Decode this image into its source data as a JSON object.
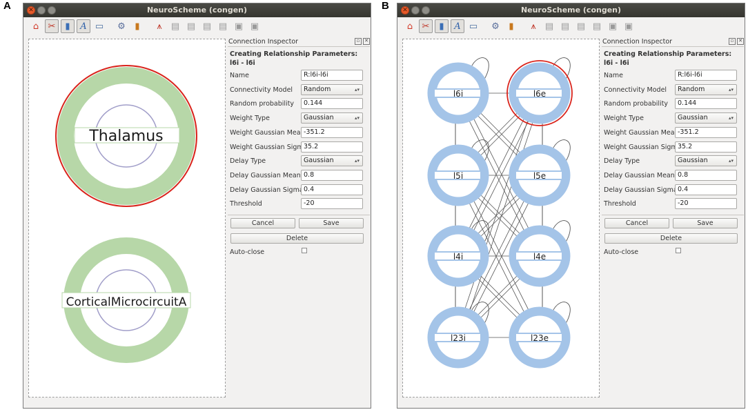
{
  "panels": [
    {
      "letter": "A",
      "window_title": "NeuroScheme (congen)",
      "toolbar_icons": [
        "home-icon",
        "scissors-icon",
        "battery-icon",
        "text-icon",
        "panel-icon",
        "separator",
        "gear-icon",
        "book-icon",
        "separator",
        "antenna-icon",
        "clipboard-icon",
        "clipboard-icon",
        "clipboard-icon",
        "clipboard-icon",
        "window-icon",
        "window-icon"
      ],
      "inspector": {
        "title": "Connection Inspector",
        "heading_line1": "Creating Relationship Parameters:",
        "heading_line2": "l6i - l6i",
        "fields": [
          {
            "label": "Name",
            "value": "R:l6i-l6i",
            "kind": "text"
          },
          {
            "label": "Connectivity Model",
            "value": "Random",
            "kind": "select"
          },
          {
            "label": "Random probability",
            "value": "0.144",
            "kind": "text"
          },
          {
            "label": "Weight Type",
            "value": "Gaussian",
            "kind": "select"
          },
          {
            "label": "Weight Gaussian Mean",
            "value": "-351.2",
            "kind": "text"
          },
          {
            "label": "Weight Gaussian Sigma",
            "value": "35.2",
            "kind": "text"
          },
          {
            "label": "Delay Type",
            "value": "Gaussian",
            "kind": "select"
          },
          {
            "label": "Delay Gaussian Mean",
            "value": "0.8",
            "kind": "text"
          },
          {
            "label": "Delay Gaussian Sigma",
            "value": "0.4",
            "kind": "text"
          },
          {
            "label": "Threshold",
            "value": "-20",
            "kind": "text"
          }
        ],
        "cancel_label": "Cancel",
        "save_label": "Save",
        "delete_label": "Delete",
        "autoclose_label": "Auto-close"
      },
      "nodes": [
        {
          "label": "Thalamus",
          "selected": true
        },
        {
          "label": "CorticalMicrocircuitA",
          "selected": false
        }
      ]
    },
    {
      "letter": "B",
      "window_title": "NeuroScheme (congen)",
      "toolbar_icons": [
        "home-icon",
        "scissors-icon",
        "battery-icon",
        "text-icon",
        "panel-icon",
        "separator",
        "gear-icon",
        "book-icon",
        "separator",
        "antenna-icon",
        "clipboard-icon",
        "clipboard-icon",
        "clipboard-icon",
        "clipboard-icon",
        "window-icon",
        "window-icon"
      ],
      "inspector": {
        "title": "Connection Inspector",
        "heading_line1": "Creating Relationship Parameters:",
        "heading_line2": "l6i - l6i",
        "fields": [
          {
            "label": "Name",
            "value": "R:l6i-l6i",
            "kind": "text"
          },
          {
            "label": "Connectivity Model",
            "value": "Random",
            "kind": "select"
          },
          {
            "label": "Random probability",
            "value": "0.144",
            "kind": "text"
          },
          {
            "label": "Weight Type",
            "value": "Gaussian",
            "kind": "select"
          },
          {
            "label": "Weight Gaussian Mean",
            "value": "-351.2",
            "kind": "text"
          },
          {
            "label": "Weight Gaussian Sigma",
            "value": "35.2",
            "kind": "text"
          },
          {
            "label": "Delay Type",
            "value": "Gaussian",
            "kind": "select"
          },
          {
            "label": "Delay Gaussian Mean",
            "value": "0.8",
            "kind": "text"
          },
          {
            "label": "Delay Gaussian Sigma",
            "value": "0.4",
            "kind": "text"
          },
          {
            "label": "Threshold",
            "value": "-20",
            "kind": "text"
          }
        ],
        "cancel_label": "Cancel",
        "save_label": "Save",
        "delete_label": "Delete",
        "autoclose_label": "Auto-close"
      },
      "nodes": [
        {
          "label": "l6i",
          "selected": false
        },
        {
          "label": "l6e",
          "selected": true
        },
        {
          "label": "l5i",
          "selected": false
        },
        {
          "label": "l5e",
          "selected": false
        },
        {
          "label": "l4i",
          "selected": false
        },
        {
          "label": "l4e",
          "selected": false
        },
        {
          "label": "l23i",
          "selected": false
        },
        {
          "label": "l23e",
          "selected": false
        }
      ]
    }
  ],
  "colors": {
    "green_ring": "#b7d7a8",
    "blue_ring": "#a4c4e8",
    "purple_ring": "#a19ec9",
    "selection_red": "#d9241c",
    "titlebar": "#3d3d38",
    "close_button": "#e75a2a"
  }
}
